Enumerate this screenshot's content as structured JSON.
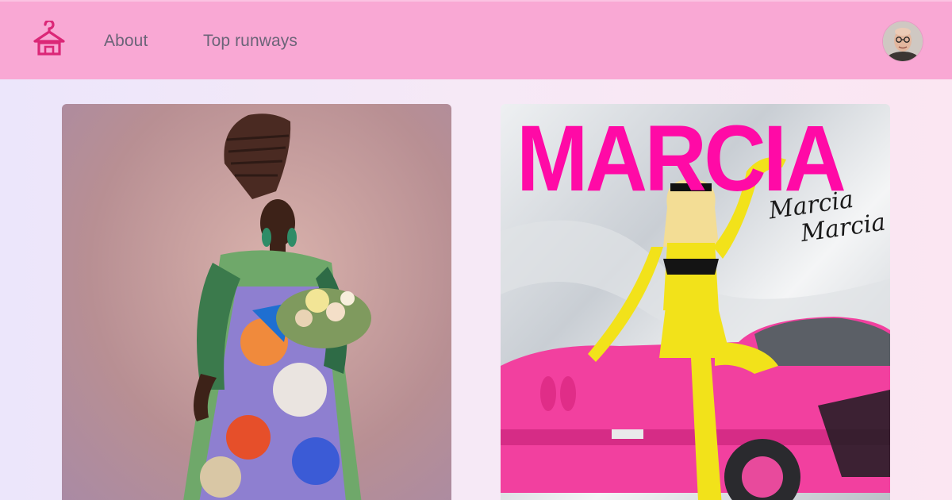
{
  "nav": {
    "logo_icon": "hanger-icon",
    "links": [
      {
        "label": "About"
      },
      {
        "label": "Top runways"
      }
    ],
    "avatar_icon": "user-avatar"
  },
  "cards": [
    {
      "kind": "photo",
      "subject": "drag-queen-runway-look"
    },
    {
      "kind": "poster",
      "title": "MARCIA",
      "script_line1": "Marcia",
      "script_line2": "Marcia"
    }
  ],
  "colors": {
    "navbar": "#f9a8d4",
    "logo": "#db2777",
    "link": "#6b6478",
    "poster_title": "#ff0aa6"
  }
}
